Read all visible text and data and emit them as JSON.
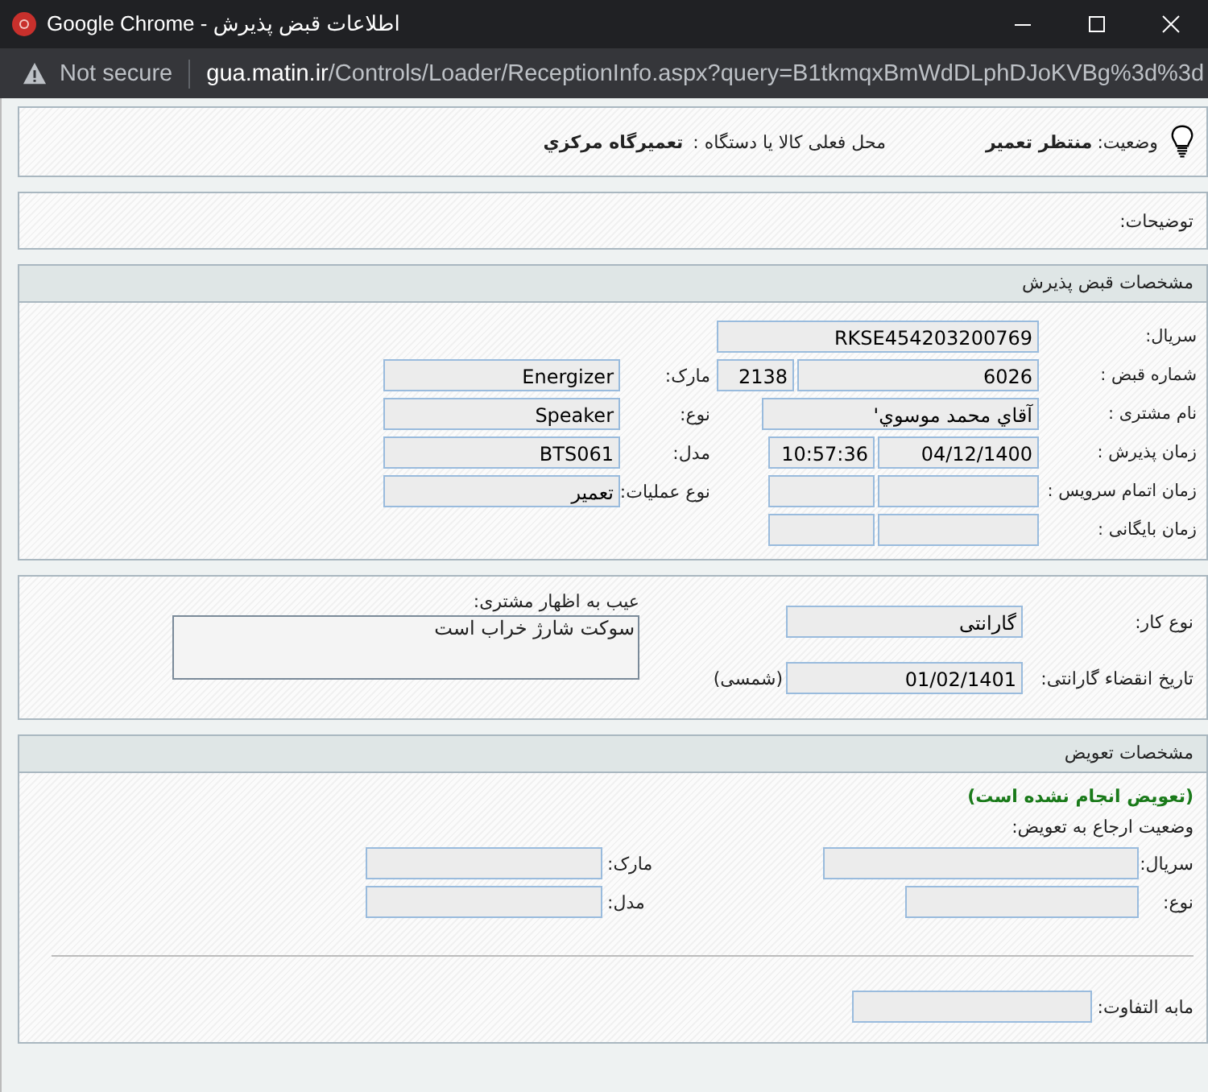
{
  "window": {
    "title": "Google Chrome - اطلاعات قبض پذیرش"
  },
  "address_bar": {
    "security": "Not secure",
    "url_host": "gua.matin.ir",
    "url_path": "/Controls/Loader/ReceptionInfo.aspx?query=B1tkmqxBmWdDLphDJoKVBg%3d%3d"
  },
  "status": {
    "label": "وضعیت:",
    "value": "منتظر تعمیر",
    "location_label": "محل فعلی کالا یا دستگاه :",
    "location_value": "تعمیرگاه مرکزي"
  },
  "description": {
    "label": "توضیحات:"
  },
  "reception": {
    "title": "مشخصات قبض پذیرش",
    "rows": [
      {
        "label": "سریال:",
        "fields": [
          {
            "kind": "serial",
            "value": "RKSE454203200769"
          }
        ]
      },
      {
        "label": "شماره قبض :",
        "fields": [
          {
            "kind": "receipt",
            "value": "6026"
          },
          {
            "kind": "code",
            "value": "2138"
          }
        ],
        "side_label": "مارک:",
        "side_value": "Energizer"
      },
      {
        "label": "نام مشتری :",
        "fields": [
          {
            "kind": "name",
            "value": "آقاي محمد موسوي'"
          }
        ],
        "side_label": "نوع:",
        "side_value": "Speaker"
      },
      {
        "label": "زمان پذیرش :",
        "fields": [
          {
            "kind": "date",
            "value": "04/12/1400"
          },
          {
            "kind": "time",
            "value": "10:57:36"
          }
        ],
        "side_label": "مدل:",
        "side_value": "BTS061"
      },
      {
        "label": "زمان اتمام سرویس :",
        "fields": [
          {
            "kind": "date"
          },
          {
            "kind": "time"
          }
        ],
        "side_label": "نوع عملیات:",
        "side_value": "تعمیر"
      },
      {
        "label": "زمان بایگانی :",
        "fields": [
          {
            "kind": "date"
          },
          {
            "kind": "time"
          }
        ]
      }
    ]
  },
  "work": {
    "type_label": "نوع کار:",
    "type_value": "گارانتی",
    "expiry_label": "تاریخ انقضاء گارانتی:",
    "expiry_value": "01/02/1401",
    "expiry_suffix": "(شمسی)",
    "defect_label": "عیب به اظهار مشتری:",
    "defect_value": "سوکت شارژ خراب است"
  },
  "replacement": {
    "title": "مشخصات تعویض",
    "notice": "(تعویض انجام نشده است)",
    "status_label": "وضعیت ارجاع به تعویض:",
    "rows": [
      {
        "label": "سریال:",
        "kind": "wide",
        "side_label": "مارک:"
      },
      {
        "label": "نوع:",
        "kind": "narrow",
        "side_label": "مدل:"
      }
    ],
    "difference_label": "مابه التفاوت:"
  }
}
